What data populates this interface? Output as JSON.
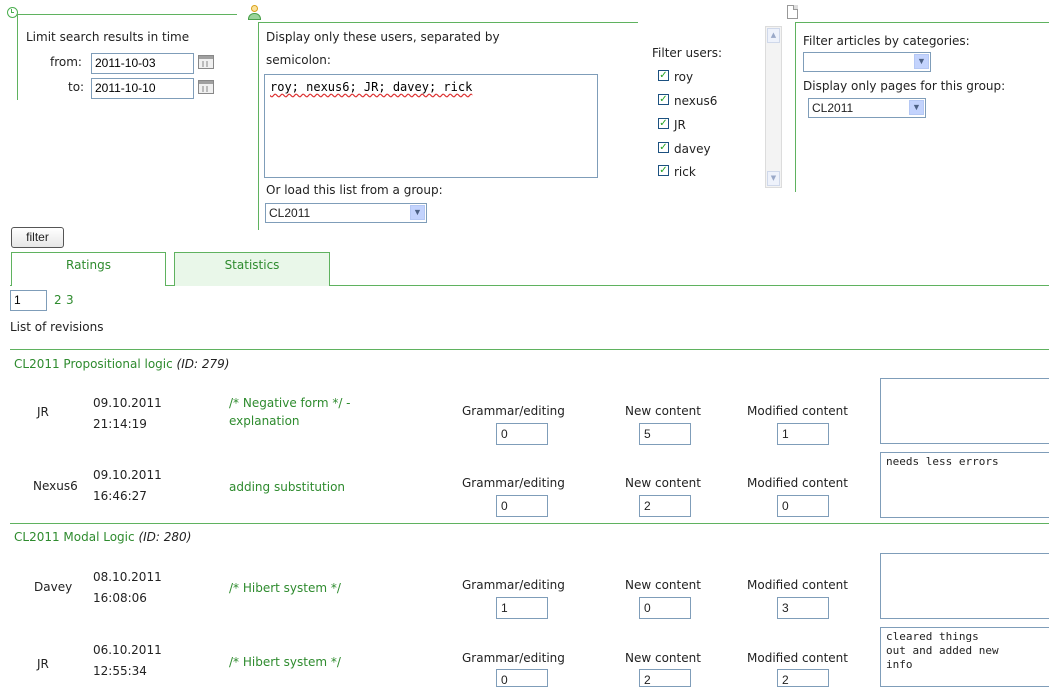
{
  "time_filter": {
    "title": "Limit search results in time",
    "from_label": "from:",
    "from_value": "2011-10-03",
    "to_label": "to:",
    "to_value": "2011-10-10"
  },
  "users_filter": {
    "title_line1": "Display only these users, separated by",
    "title_line2": "semicolon:",
    "users_text": "roy; nexus6; JR; davey; rick",
    "load_label": "Or load this list from a group:",
    "group_selected": "CL2011"
  },
  "filter_users": {
    "title": "Filter users:",
    "items": [
      "roy",
      "nexus6",
      "JR",
      "davey",
      "rick"
    ]
  },
  "category_filter": {
    "title": "Filter articles by categories:",
    "category_selected": "",
    "group_label": "Display only pages for this group:",
    "group_selected": "CL2011"
  },
  "filter_button": "filter",
  "tabs": [
    "Ratings",
    "Statistics"
  ],
  "pagination": {
    "current": "1",
    "pages": [
      "2",
      "3"
    ]
  },
  "list_title": "List of revisions",
  "id_label": "ID:",
  "groups": [
    {
      "article": "CL2011 Propositional logic",
      "id": "279",
      "revisions": [
        {
          "user": "JR",
          "date": "09.10.2011",
          "time": "21:14:19",
          "summary_l1": "/* Negative form */ -",
          "summary_l2": "explanation",
          "grammar": "0",
          "new_content": "5",
          "modified": "1",
          "comment": ""
        },
        {
          "user": "Nexus6",
          "date": "09.10.2011",
          "time": "16:46:27",
          "summary_l1": "adding substitution",
          "summary_l2": "",
          "grammar": "0",
          "new_content": "2",
          "modified": "0",
          "comment": "needs less errors"
        }
      ]
    },
    {
      "article": "CL2011 Modal Logic",
      "id": "280",
      "revisions": [
        {
          "user": "Davey",
          "date": "08.10.2011",
          "time": "16:08:06",
          "summary_l1": "/* Hibert system */",
          "summary_l2": "",
          "grammar": "1",
          "new_content": "0",
          "modified": "3",
          "comment": ""
        },
        {
          "user": "JR",
          "date": "06.10.2011",
          "time": "12:55:34",
          "summary_l1": "/* Hibert system */",
          "summary_l2": "",
          "grammar": "0",
          "new_content": "2",
          "modified": "2",
          "comment": "cleared things\nout and added new\ninfo"
        }
      ]
    }
  ],
  "column_labels": {
    "grammar": "Grammar/editing",
    "new_content": "New content",
    "modified": "Modified content"
  },
  "colors": {
    "accent": "#2e8b2e",
    "line": "#5fb25f"
  },
  "icons": [
    "clock-icon",
    "user-icon",
    "page-icon",
    "calendar-icon"
  ]
}
